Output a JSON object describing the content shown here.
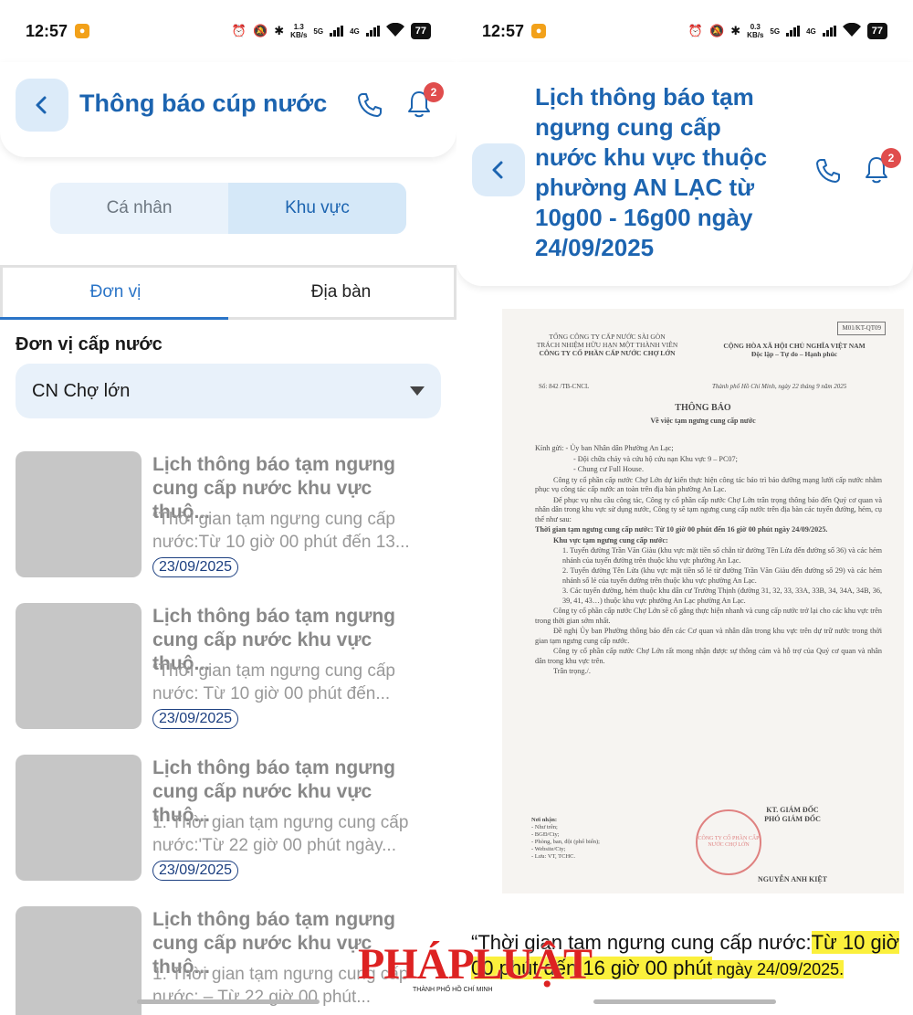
{
  "left": {
    "status": {
      "time": "12:57",
      "speed_top": "1.3",
      "speed_unit": "KB/s",
      "net1": "5G",
      "net2": "4G",
      "battery": "77"
    },
    "header": {
      "title": "Thông báo cúp nước",
      "badge": "2"
    },
    "segments": [
      "Cá nhân",
      "Khu vực"
    ],
    "subtabs": [
      "Đơn vị",
      "Địa bàn"
    ],
    "field_label": "Đơn vị cấp nước",
    "dropdown_value": "CN Chợ lớn",
    "items": [
      {
        "title": "Lịch thông báo tạm ngưng cung cấp nước khu vực thuộ...",
        "desc": "“Thời gian tạm ngưng cung cấp nước:Từ 10 giờ 00 phút đến 13...",
        "date": "23/09/2025"
      },
      {
        "title": "Lịch thông báo tạm ngưng cung cấp nước khu vực thuộ...",
        "desc": "“Thời gian tạm ngưng cung cấp nước: Từ 10 giờ 00 phút đến...",
        "date": "23/09/2025"
      },
      {
        "title": "Lịch thông báo tạm ngưng cung cấp nước khu vực thuộ...",
        "desc": "1. Thời gian tạm ngưng cung cấp nước:'Từ 22 giờ 00 phút ngày...",
        "date": "23/09/2025"
      },
      {
        "title": "Lịch thông báo tạm ngưng cung cấp nước khu vực thuộ...",
        "desc": "1. Thời gian tạm ngưng cung cấp nước: – Từ 22 giờ 00 phút...",
        "date": ""
      }
    ]
  },
  "right": {
    "status": {
      "time": "12:57",
      "speed_top": "0.3",
      "speed_unit": "KB/s",
      "net1": "5G",
      "net2": "4G",
      "battery": "77"
    },
    "header": {
      "title": "Lịch thông báo tạm ngưng cung cấp nước khu vực thuộc phường AN LẠC từ 10g00 - 16g00 ngày 24/09/2025",
      "badge": "2"
    },
    "document": {
      "code": "M01/KT-QT09",
      "org_line1": "TỔNG CÔNG TY CẤP NƯỚC SÀI GÒN",
      "org_line2": "TRÁCH NHIỆM HỮU HẠN MỘT THÀNH VIÊN",
      "org_line3": "CÔNG TY CỔ PHẦN CẤP NƯỚC CHỢ LỚN",
      "nation_line1": "CỘNG HÒA XÃ HỘI CHỦ NGHĨA VIỆT NAM",
      "nation_line2": "Độc lập – Tự do – Hạnh phúc",
      "number": "Số: 842 /TB-CNCL",
      "place": "Thành phố Hồ Chí Minh, ngày 22 tháng 9 năm 2025",
      "title": "THÔNG BÁO",
      "subtitle": "Về việc tạm ngưng cung cấp nước",
      "body": [
        "Kính gửi: - Ủy ban Nhân dân Phường An Lạc;",
        "- Đội chữa cháy và cứu hộ cứu nạn Khu vực 9 – PC07;",
        "- Chung cư Full House.",
        "Công ty cổ phần cấp nước Chợ Lớn dự kiến thực hiện công tác bảo trì bảo dưỡng mạng lưới cấp nước nhằm phục vụ công tác cấp nước an toàn trên địa bàn phường An Lạc.",
        "Để phục vụ nhu cầu công tác, Công ty cổ phần cấp nước Chợ Lớn trân trọng thông báo đến Quý cơ quan và nhân dân trong khu vực sử dụng nước, Công ty sẽ tạm ngưng cung cấp nước trên địa bàn các tuyến đường, hẻm, cụ thể như sau:",
        "Thời gian tạm ngưng cung cấp nước: Từ 10 giờ 00 phút đến 16 giờ 00 phút ngày 24/09/2025.",
        "Khu vực tạm ngưng cung cấp nước:",
        "1. Tuyến đường Trần Văn Giàu (khu vực mặt tiền số chẵn từ đường Tên Lửa đến đường số 36) và các hẻm nhánh của tuyến đường trên thuộc khu vực phường An Lạc.",
        "2. Tuyến đường Tên Lửa (khu vực mặt tiền số lẻ từ đường Trần Văn Giàu đến đường số 29) và các hẻm nhánh số lẻ của tuyến đường trên thuộc khu vực phường An Lạc.",
        "3. Các tuyến đường, hẻm thuộc khu dân cư Trường Thịnh (đường 31, 32, 33, 33A, 33B, 34, 34A, 34B, 36, 39, 41, 43…) thuộc khu vực phường An Lạc phường An Lạc.",
        "Công ty cổ phần cấp nước Chợ Lớn sẽ cố gắng thực hiện nhanh và cung cấp nước trở lại cho các khu vực trên trong thời gian sớm nhất.",
        "Đề nghị Ủy ban Phường thông báo đến các Cơ quan và nhân dân trong khu vực trên dự trữ nước trong thời gian tạm ngưng cung cấp nước.",
        "Công ty cổ phần cấp nước Chợ Lớn rất mong nhận được sự thông cảm và hỗ trợ của Quý cơ quan và nhân dân trong khu vực trên.",
        "Trân trọng./."
      ],
      "recipients": [
        "Nơi nhận:",
        "- Như trên;",
        "- BGĐ/Cty;",
        "- Phòng, ban, đội (phổ biến);",
        "- Website/Cty;",
        "- Lưu: VT, TCHC."
      ],
      "sign_line1": "KT. GIÁM ĐỐC",
      "sign_line2": "PHÓ GIÁM ĐỐC",
      "stamp_text": "CÔNG TY CỔ PHẦN CẤP NƯỚC CHỢ LỚN",
      "signer": "NGUYỄN ANH KIỆT"
    },
    "quote": {
      "part1": "“Thời gian tạm ngưng cung cấp nước:",
      "part2": "Từ 10 giờ 00 phút đến 16 giờ 00 phút",
      "part3": " ngày 24/09/2025."
    },
    "watermark": {
      "text": "PHÁPLUẬT",
      "sub": "THÀNH PHỐ HỒ CHÍ MINH"
    }
  },
  "colors": {
    "accent": "#1c64b0",
    "badge": "#e04d4d",
    "highlight": "#fbf03c",
    "thumb": "#c6c6c6"
  },
  "icons": [
    "back-arrow-icon",
    "phone-icon",
    "bell-icon",
    "dropdown-caret-icon",
    "alarm-icon",
    "mute-icon",
    "bluetooth-icon",
    "wifi-icon",
    "battery-icon"
  ]
}
